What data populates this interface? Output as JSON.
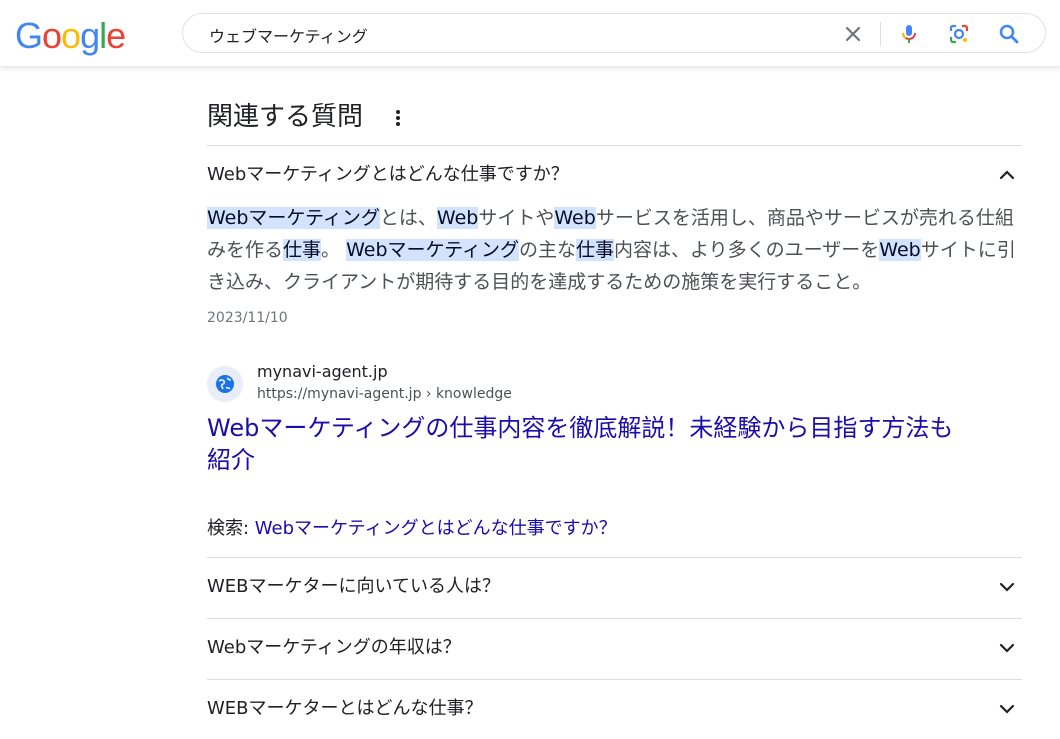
{
  "header": {
    "logo_letters": [
      "G",
      "o",
      "o",
      "g",
      "l",
      "e"
    ],
    "logo_colors": [
      "#4285F4",
      "#EA4335",
      "#FBBC05",
      "#4285F4",
      "#34A853",
      "#EA4335"
    ],
    "query": "ウェブマーケティング",
    "icons": [
      "close-icon",
      "mic-icon",
      "lens-icon",
      "search-icon"
    ]
  },
  "paa": {
    "title": "関連する質問",
    "expanded_question": "Webマーケティングとはどんな仕事ですか？",
    "answer_segments": [
      {
        "t": "Webマーケティング",
        "h": true
      },
      {
        "t": "とは、",
        "h": false
      },
      {
        "t": "Web",
        "h": true
      },
      {
        "t": "サイトや",
        "h": false
      },
      {
        "t": "Web",
        "h": true
      },
      {
        "t": "サービスを活用し、商品やサービスが売れる仕組みを作る",
        "h": false
      },
      {
        "t": "仕事",
        "h": true
      },
      {
        "t": "。 ",
        "h": false
      },
      {
        "t": "Webマーケティング",
        "h": true
      },
      {
        "t": "の主な",
        "h": false
      },
      {
        "t": "仕事",
        "h": true
      },
      {
        "t": "内容は、より多くのユーザーを",
        "h": false
      },
      {
        "t": "Web",
        "h": true
      },
      {
        "t": "サイトに引き込み、クライアントが期待する目的を達成するための施策を実行すること。",
        "h": false
      }
    ],
    "date": "2023/11/10",
    "source": {
      "site_name": "mynavi-agent.jp",
      "url": "https://mynavi-agent.jp › knowledge",
      "title": "Webマーケティングの仕事内容を徹底解説！未経験から目指す方法も紹介"
    },
    "search_for_label": "検索: ",
    "search_for_link": "Webマーケティングとはどんな仕事ですか？",
    "questions": [
      "WEBマーケターに向いている人は？",
      "Webマーケティングの年収は？",
      "WEBマーケターとはどんな仕事？"
    ]
  }
}
